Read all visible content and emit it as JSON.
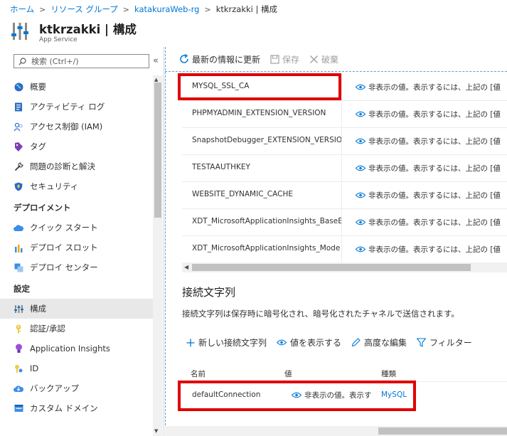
{
  "breadcrumb": {
    "items": [
      "ホーム",
      "リソース グループ",
      "katakuraWeb-rg"
    ],
    "separator": ">",
    "current": "ktkrzakki | 構成"
  },
  "header": {
    "title": "ktkrzakki | 構成",
    "subtitle": "App Service"
  },
  "sidebar": {
    "search_placeholder": "検索 (Ctrl+/)",
    "collapse_glyph": "«",
    "items": [
      {
        "label": "概要",
        "icon": "globe-icon"
      },
      {
        "label": "アクティビティ ログ",
        "icon": "activity-log-icon"
      },
      {
        "label": "アクセス制御 (IAM)",
        "icon": "users-icon"
      },
      {
        "label": "タグ",
        "icon": "tag-icon"
      },
      {
        "label": "問題の診断と解決",
        "icon": "wrench-icon"
      },
      {
        "label": "セキュリティ",
        "icon": "shield-icon"
      }
    ],
    "section_deploy": "デプロイメント",
    "deploy_items": [
      {
        "label": "クイック スタート",
        "icon": "cloud-icon"
      },
      {
        "label": "デプロイ スロット",
        "icon": "slots-icon"
      },
      {
        "label": "デプロイ センター",
        "icon": "deploy-center-icon"
      }
    ],
    "section_settings": "設定",
    "settings_items": [
      {
        "label": "構成",
        "icon": "config-icon"
      },
      {
        "label": "認証/承認",
        "icon": "key-icon"
      },
      {
        "label": "Application Insights",
        "icon": "lightbulb-icon"
      },
      {
        "label": "ID",
        "icon": "id-icon"
      },
      {
        "label": "バックアップ",
        "icon": "backup-icon"
      },
      {
        "label": "カスタム ドメイン",
        "icon": "domain-icon"
      }
    ]
  },
  "toolbar": {
    "refresh_label": "最新の情報に更新",
    "save_label": "保存",
    "discard_label": "破棄"
  },
  "app_settings": {
    "rows": [
      {
        "name": "MYSQL_SSL_CA",
        "value": "非表示の値。表示するには、上記の [値"
      },
      {
        "name": "PHPMYADMIN_EXTENSION_VERSION",
        "value": "非表示の値。表示するには、上記の [値"
      },
      {
        "name": "SnapshotDebugger_EXTENSION_VERSION",
        "value": "非表示の値。表示するには、上記の [値"
      },
      {
        "name": "TESTAAUTHKEY",
        "value": "非表示の値。表示するには、上記の [値"
      },
      {
        "name": "WEBSITE_DYNAMIC_CACHE",
        "value": "非表示の値。表示するには、上記の [値"
      },
      {
        "name": "XDT_MicrosoftApplicationInsights_BaseExtensions",
        "value": "非表示の値。表示するには、上記の [値"
      },
      {
        "name": "XDT_MicrosoftApplicationInsights_Mode",
        "value": "非表示の値。表示するには、上記の [値"
      }
    ]
  },
  "connection_strings": {
    "title": "接続文字列",
    "description": "接続文字列は保存時に暗号化され、暗号化されたチャネルで送信されます。",
    "new_label": "新しい接続文字列",
    "show_values_label": "値を表示する",
    "advanced_edit_label": "高度な編集",
    "filter_label": "フィルター",
    "columns": {
      "name": "名前",
      "value": "値",
      "type": "種類"
    },
    "rows": [
      {
        "name": "defaultConnection",
        "value": "非表示の値。表示するには",
        "type": "MySQL"
      }
    ]
  },
  "colors": {
    "accent": "#0078d4",
    "highlight": "#e00000"
  }
}
